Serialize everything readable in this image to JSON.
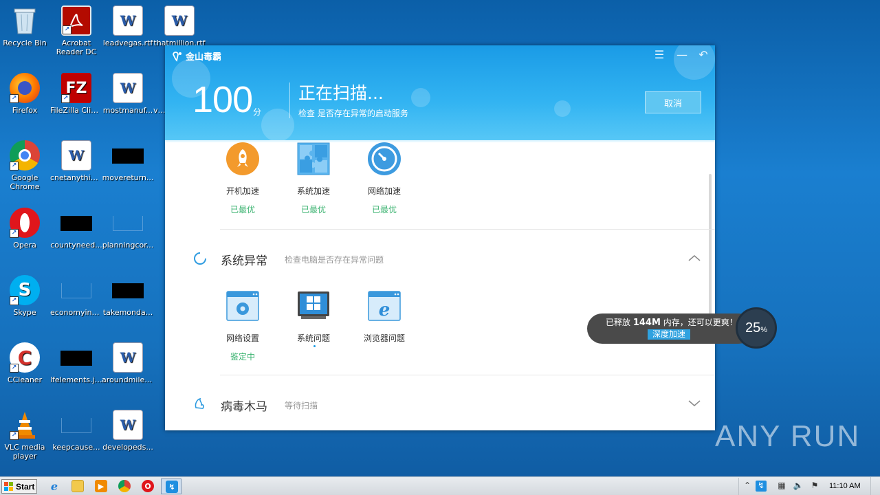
{
  "desktop": {
    "icons": [
      {
        "label": "Recycle Bin"
      },
      {
        "label": "Acrobat Reader DC"
      },
      {
        "label": "leadvegas.rtf"
      },
      {
        "label": "thatmillion.rtf"
      },
      {
        "label": "Firefox"
      },
      {
        "label": "FileZilla Client"
      },
      {
        "label": "mostmanuf..."
      },
      {
        "label": "vi..."
      },
      {
        "label": "Google Chrome"
      },
      {
        "label": "cnetanythin..."
      },
      {
        "label": "movereturn..."
      },
      {
        "label": "Opera"
      },
      {
        "label": "countyneed..."
      },
      {
        "label": "planningcor..."
      },
      {
        "label": "Skype"
      },
      {
        "label": "economyindi..."
      },
      {
        "label": "takemonda..."
      },
      {
        "label": "CCleaner"
      },
      {
        "label": "lfelements.jpg"
      },
      {
        "label": "aroundmiles..."
      },
      {
        "label": "VLC media player"
      },
      {
        "label": "keepcause..."
      },
      {
        "label": "developeds..."
      }
    ],
    "watermark": "ANY RUN"
  },
  "app": {
    "title": "金山毒霸",
    "score": "100",
    "score_unit": "分",
    "scan_title": "正在扫描...",
    "scan_sub": "检查 是否存在异常的启动服务",
    "cancel_label": "取消",
    "speed_items": [
      {
        "label": "开机加速",
        "status": "已最优",
        "icon": "rocket-icon"
      },
      {
        "label": "系统加速",
        "status": "已最优",
        "icon": "puzzle-icon"
      },
      {
        "label": "网络加速",
        "status": "已最优",
        "icon": "speedometer-icon"
      }
    ],
    "section_system": {
      "title": "系统异常",
      "subtitle": "检查电脑是否存在异常问题"
    },
    "system_items": [
      {
        "label": "网络设置",
        "status": "鉴定中",
        "icon": "network-settings-icon"
      },
      {
        "label": "系统问题",
        "status": "",
        "icon": "windows-icon"
      },
      {
        "label": "浏览器问题",
        "status": "",
        "icon": "ie-browser-icon"
      }
    ],
    "section_virus": {
      "title": "病毒木马",
      "subtitle": "等待扫描"
    }
  },
  "memory_popup": {
    "text_prefix": "已释放",
    "amount": "144M",
    "text_suffix": "内存，还可以更爽！",
    "button_label": "深度加速",
    "percent": "25",
    "percent_sign": "%"
  },
  "taskbar": {
    "start_label": "Start",
    "clock": "11:10 AM"
  }
}
